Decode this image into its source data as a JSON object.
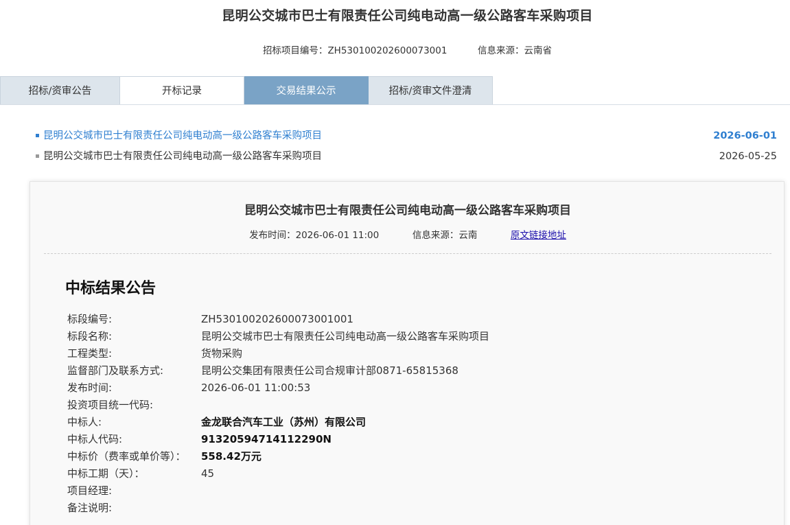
{
  "project": {
    "title": "昆明公交城市巴士有限责任公司纯电动高一级公路客车采购项目",
    "code_label": "招标项目编号：",
    "code": "ZH530100202600073001",
    "source_label": "信息来源：",
    "source": "云南省"
  },
  "tabs": [
    {
      "label": "招标/资审公告"
    },
    {
      "label": "开标记录"
    },
    {
      "label": "交易结果公示",
      "active": true
    },
    {
      "label": "招标/资审文件澄清"
    }
  ],
  "notices": [
    {
      "title": "昆明公交城市巴士有限责任公司纯电动高一级公路客车采购项目",
      "date": "2026-06-01",
      "active": true
    },
    {
      "title": "昆明公交城市巴士有限责任公司纯电动高一级公路客车采购项目",
      "date": "2026-05-25",
      "active": false
    }
  ],
  "detail": {
    "title": "昆明公交城市巴士有限责任公司纯电动高一级公路客车采购项目",
    "publish_label": "发布时间：",
    "publish_time": "2026-06-01 11:00",
    "source_label": "信息来源：",
    "source": "云南",
    "link_label": "原文链接地址",
    "announce_title": "中标结果公告",
    "fields": [
      {
        "label": "标段编号:",
        "value": "ZH530100202600073001001"
      },
      {
        "label": "标段名称:",
        "value": "昆明公交城市巴士有限责任公司纯电动高一级公路客车采购项目"
      },
      {
        "label": "工程类型:",
        "value": "货物采购"
      },
      {
        "label": "监督部门及联系方式:",
        "value": "昆明公交集团有限责任公司合规审计部0871-65815368"
      },
      {
        "label": "发布时间:",
        "value": "2026-06-01 11:00:53"
      },
      {
        "label": "投资项目统一代码:",
        "value": ""
      },
      {
        "label": "中标人:",
        "value": "金龙联合汽车工业（苏州）有限公司",
        "bold": true
      },
      {
        "label": "中标人代码:",
        "value": "91320594714112290N",
        "bold": true
      },
      {
        "label": "中标价（费率或单价等）：",
        "value": "558.42万元",
        "bold": true
      },
      {
        "label": "中标工期（天）：",
        "value": "45"
      },
      {
        "label": "项目经理:",
        "value": ""
      },
      {
        "label": "备注说明:",
        "value": ""
      }
    ]
  }
}
